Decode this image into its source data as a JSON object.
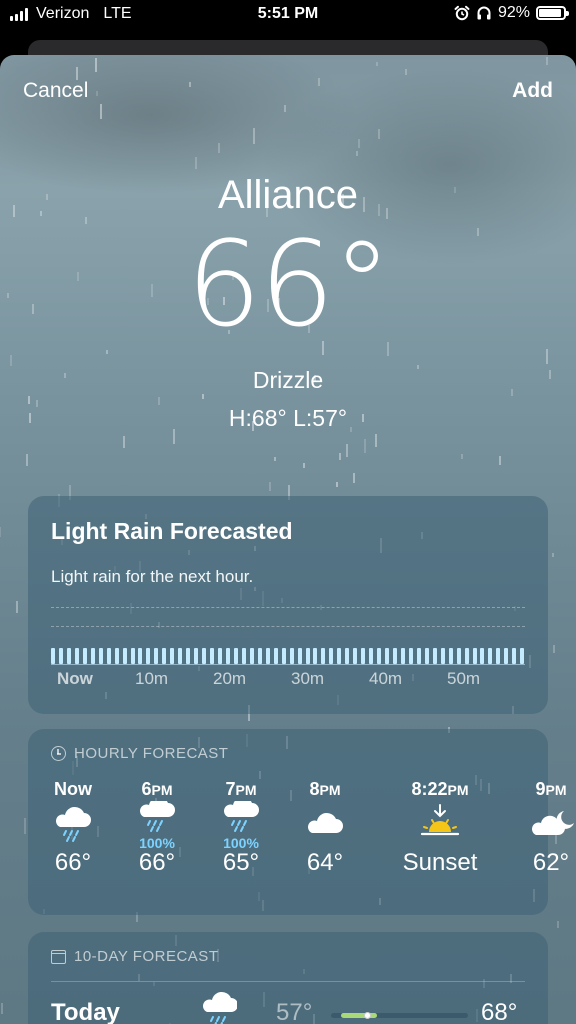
{
  "status_bar": {
    "carrier": "Verizon",
    "network": "LTE",
    "time": "5:51 PM",
    "battery": "92%",
    "battery_level": 0.92
  },
  "nav": {
    "cancel_label": "Cancel",
    "add_label": "Add"
  },
  "current": {
    "city": "Alliance",
    "temperature": "66°",
    "condition": "Drizzle",
    "high_low": "H:68°  L:57°"
  },
  "precip_card": {
    "title": "Light Rain Forecasted",
    "description": "Light rain for the next hour.",
    "time_labels": [
      "Now",
      "10m",
      "20m",
      "30m",
      "40m",
      "50m"
    ]
  },
  "hourly": {
    "header": "HOURLY FORECAST",
    "items": [
      {
        "time": "Now",
        "suffix": "",
        "icon": "rain-cloud-icon",
        "chance": "",
        "temp": "66°"
      },
      {
        "time": "6",
        "suffix": "PM",
        "icon": "rain-cloud-icon",
        "chance": "100%",
        "temp": "66°"
      },
      {
        "time": "7",
        "suffix": "PM",
        "icon": "rain-cloud-icon",
        "chance": "100%",
        "temp": "65°"
      },
      {
        "time": "8",
        "suffix": "PM",
        "icon": "cloud-icon",
        "chance": "",
        "temp": "64°"
      },
      {
        "time": "8:22",
        "suffix": "PM",
        "icon": "sunset-icon",
        "chance": "",
        "temp": "Sunset"
      },
      {
        "time": "9",
        "suffix": "PM",
        "icon": "partly-cloudy-night-icon",
        "chance": "",
        "temp": "62°"
      }
    ]
  },
  "ten_day": {
    "header": "10-DAY FORECAST",
    "today": {
      "day": "Today",
      "icon": "rain-cloud-icon",
      "low": "57°",
      "high": "68°"
    }
  },
  "colors": {
    "precip_bar": "#c4ebff",
    "chance_text": "#7dd3ff",
    "range_fill": "#a8d878",
    "sun": "#f5c518"
  }
}
